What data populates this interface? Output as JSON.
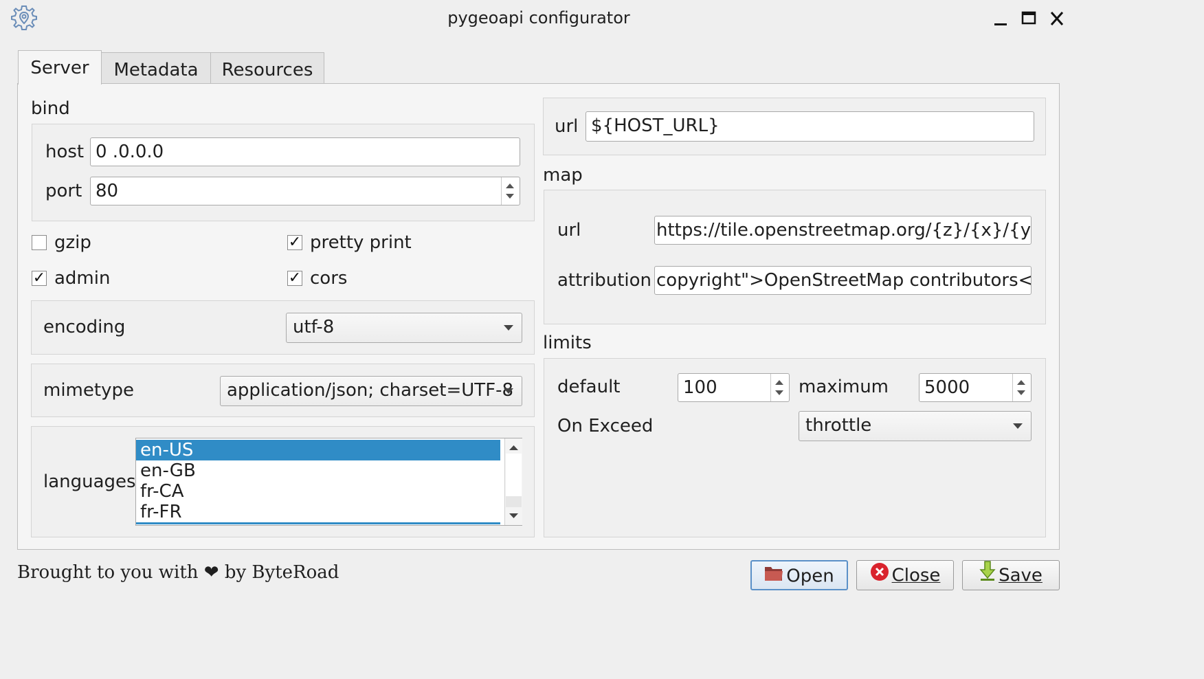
{
  "window": {
    "title": "pygeoapi configurator",
    "icon": "gear-location-icon",
    "controls": {
      "minimize": "▁",
      "maximize": "☐",
      "close": "✕"
    }
  },
  "tabs": [
    {
      "label": "Server",
      "active": true
    },
    {
      "label": "Metadata",
      "active": false
    },
    {
      "label": "Resources",
      "active": false
    }
  ],
  "server": {
    "bind": {
      "title": "bind",
      "host_label": "host",
      "host_value": "0  .0.0.0",
      "port_label": "port",
      "port_value": "80"
    },
    "checkboxes": {
      "gzip": {
        "label": "gzip",
        "checked": false,
        "mark": ""
      },
      "pretty_print": {
        "label": "pretty print",
        "checked": true,
        "mark": "✓"
      },
      "admin": {
        "label": "admin",
        "checked": true,
        "mark": "✓"
      },
      "cors": {
        "label": "cors",
        "checked": true,
        "mark": "✓"
      }
    },
    "encoding": {
      "label": "encoding",
      "value": "utf-8"
    },
    "mimetype": {
      "label": "mimetype",
      "value": "application/json; charset=UTF-8"
    },
    "languages": {
      "label": "languages",
      "items": [
        "en-US",
        "en-GB",
        "fr-CA",
        "fr-FR"
      ],
      "selected": "en-US"
    },
    "url": {
      "label": "url",
      "value": "${HOST_URL}"
    },
    "map": {
      "title": "map",
      "url_label": "url",
      "url_value": "https://tile.openstreetmap.org/{z}/{x}/{y}.png",
      "attribution_label": "attribution",
      "attribution_value": "copyright\">OpenStreetMap contributors</a>"
    },
    "limits": {
      "title": "limits",
      "default_label": "default",
      "default_value": "100",
      "maximum_label": "maximum",
      "maximum_value": "5000",
      "on_exceed_label": "On Exceed",
      "on_exceed_value": "throttle"
    }
  },
  "footer": {
    "credit": "Brought to you with ❤ by ByteRoad",
    "buttons": {
      "open": "Open",
      "close": "Close",
      "save": "Save"
    }
  },
  "colors": {
    "selection": "#308cc6",
    "close_icon": "#d9232d",
    "save_icon": "#7dbb28",
    "open_icon": "#b94a48"
  }
}
